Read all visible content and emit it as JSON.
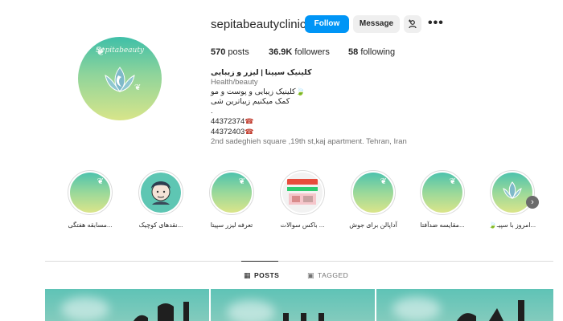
{
  "profile": {
    "username": "sepitabeautyclinic",
    "follow_label": "Follow",
    "message_label": "Message",
    "add_user_icon": "add-user-icon",
    "more_icon": "more-options-icon",
    "avatar_logo_text": "Sepitabeauty"
  },
  "stats": {
    "posts_count": "570",
    "posts_label": "posts",
    "followers_count": "36.9K",
    "followers_label": "followers",
    "following_count": "58",
    "following_label": "following"
  },
  "bio": {
    "name": "کلینیک سپیتا | لیزر و زیبایی",
    "category": "Health/beauty",
    "line1": "کلینیک زیبایی و پوست و مو",
    "line2": "کمک میکنیم زیباترین شی",
    "line3": ".",
    "phone1": "44372374",
    "phone2": "44372403",
    "address": "2nd sadeghieh square ,19th st,kaj apartment. Tehran, Iran"
  },
  "highlights": [
    {
      "label": "مسابقه هفتگی..."
    },
    {
      "label": "نقدهای کوچیک..."
    },
    {
      "label": "تعرفه لیزر سپیتا"
    },
    {
      "label": "باکس سوالات ..."
    },
    {
      "label": "آداپالن برای جوش"
    },
    {
      "label": "مقایسه ضدآفتا..."
    },
    {
      "label": "🍃امروز با سپیـ..."
    }
  ],
  "tabs": {
    "posts": "POSTS",
    "tagged": "TAGGED"
  },
  "colors": {
    "follow_button": "#0095f6",
    "message_button": "#efefef",
    "accent_teal": "#3fbfa8"
  }
}
